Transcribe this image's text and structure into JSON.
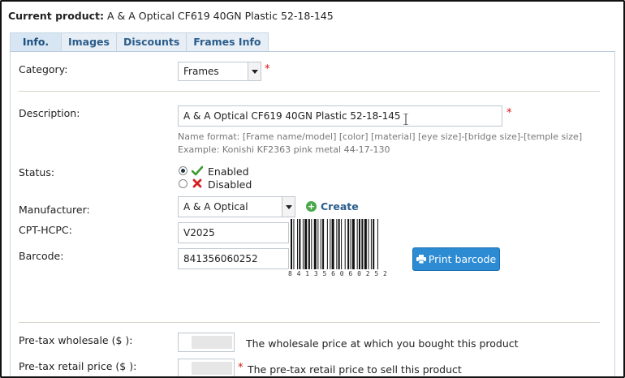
{
  "header": {
    "label": "Current product:",
    "value": "A & A Optical CF619 40GN Plastic 52-18-145"
  },
  "tabs": [
    {
      "label": "Info."
    },
    {
      "label": "Images"
    },
    {
      "label": "Discounts"
    },
    {
      "label": "Frames Info"
    }
  ],
  "form": {
    "category_label": "Category:",
    "category_value": "Frames",
    "description_label": "Description:",
    "description_value": "A & A Optical CF619 40GN Plastic 52-18-145",
    "hint_line1": "Name format: [Frame name/model] [color] [material] [eye size]-[bridge size]-[temple size]",
    "hint_line2": "Example: Konishi KF2363 pink metal 44-17-130",
    "status_label": "Status:",
    "status_enabled": "Enabled",
    "status_disabled": "Disabled",
    "manufacturer_label": "Manufacturer:",
    "manufacturer_value": "A & A Optical",
    "create_label": "Create",
    "cpt_label": "CPT-HCPC:",
    "cpt_value": "V2025",
    "barcode_label": "Barcode:",
    "barcode_value": "841356060252",
    "barcode_digits": "8 4 1 3 5 6 0 6 0 2 5 2",
    "print_barcode_label": "Print barcode",
    "wholesale_label": "Pre-tax wholesale ($ ):",
    "wholesale_desc": "The wholesale price at which you bought this product",
    "retail_label": "Pre-tax retail price ($ ):",
    "retail_desc": "The pre-tax retail price to sell this product"
  },
  "colors": {
    "accent": "#2d8bd3",
    "link": "#2a5d8c",
    "required": "#dd1111"
  }
}
